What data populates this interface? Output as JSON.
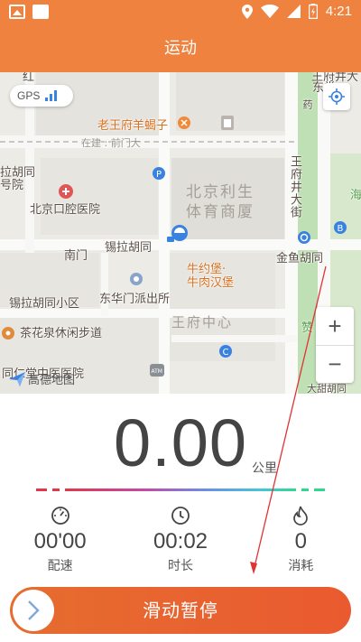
{
  "status_bar": {
    "time": "4:21",
    "icons": [
      "image-icon",
      "square-icon",
      "location-icon",
      "wifi-icon",
      "signal-icon",
      "battery-charging-icon"
    ]
  },
  "header": {
    "title": "运动"
  },
  "map": {
    "gps_label": "GPS",
    "labels": {
      "wangfujing_top": "王府井大",
      "dongtang": "东堂",
      "hong": "红",
      "yao": "药",
      "laowangfu": "老王府羊蝎子",
      "zaixi": "在建 : 前门大",
      "lagou": "拉胡同",
      "hao": "号院",
      "beijing_kq": "北京口腔医院",
      "beijing_lisheng": "北京利生",
      "tiyu": "体育商厦",
      "wangfujing_dajie": "王府井大街",
      "hai": "海",
      "nanmen": "南门",
      "xila": "锡拉胡同",
      "jinyu": "金鱼胡同",
      "niuyue": "牛约堡·",
      "niurou": "牛肉汉堡",
      "xila_xiaoqu": "锡拉胡同小区",
      "dhm": "东华门派出所",
      "chahuaquan": "茶花泉休闲步道",
      "wangfu_center": "王府中心",
      "tongren": "同仁堂中医医院",
      "zan": "赞",
      "ting": "大甜胡同",
      "gaode": "高德地图"
    },
    "pois": [
      "restaurant-icon",
      "hospital-icon",
      "parking-icon",
      "bus-icon",
      "police-icon",
      "atm-icon",
      "subway-icon",
      "bank-icon"
    ]
  },
  "distance": {
    "value": "0.00",
    "unit": "公里"
  },
  "stats": [
    {
      "value": "00'00",
      "label": "配速",
      "icon": "speedometer-icon"
    },
    {
      "value": "00:02",
      "label": "时长",
      "icon": "clock-icon"
    },
    {
      "value": "0",
      "label": "消耗",
      "icon": "flame-icon"
    }
  ],
  "slider": {
    "label": "滑动暂停"
  },
  "colors": {
    "accent": "#f0823f",
    "slider": "#e96530",
    "gps_blue": "#3a82e0"
  }
}
